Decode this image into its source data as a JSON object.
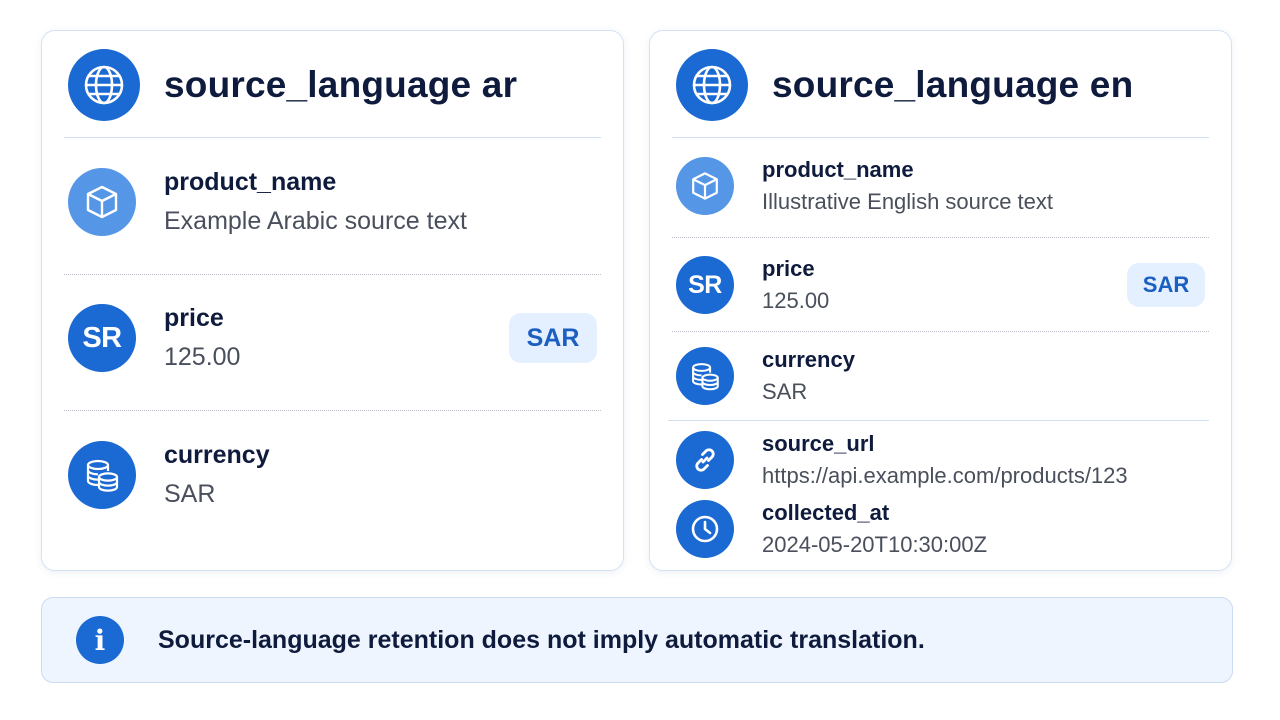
{
  "colors": {
    "accent": "#1b69d2",
    "accent_light": "#5597e6",
    "badge_bg": "#e4efff",
    "info_bg": "#eef5ff"
  },
  "left_card": {
    "title": "source_language ar",
    "title_icon": "globe-icon",
    "fields": [
      {
        "icon": "cube-icon",
        "label": "product_name",
        "value": "Example Arabic source text"
      },
      {
        "icon_text": "SR",
        "label": "price",
        "value": "125.00",
        "badge": "SAR"
      },
      {
        "icon": "coins-icon",
        "label": "currency",
        "value": "SAR"
      }
    ]
  },
  "right_card": {
    "title": "source_language en",
    "title_icon": "globe-icon",
    "fields": [
      {
        "icon": "cube-icon",
        "label": "product_name",
        "value": "Illustrative English source text"
      },
      {
        "icon_text": "SR",
        "label": "price",
        "value": "125.00",
        "badge": "SAR"
      },
      {
        "icon": "coins-icon",
        "label": "currency",
        "value": "SAR"
      },
      {
        "icon": "link-icon",
        "label": "source_url",
        "value": "https://api.example.com/products/123"
      },
      {
        "icon": "clock-icon",
        "label": "collected_at",
        "value": "2024-05-20T10:30:00Z"
      }
    ]
  },
  "notice": {
    "icon": "info-icon",
    "icon_text": "i",
    "text": "Source-language retention does not imply automatic translation."
  }
}
